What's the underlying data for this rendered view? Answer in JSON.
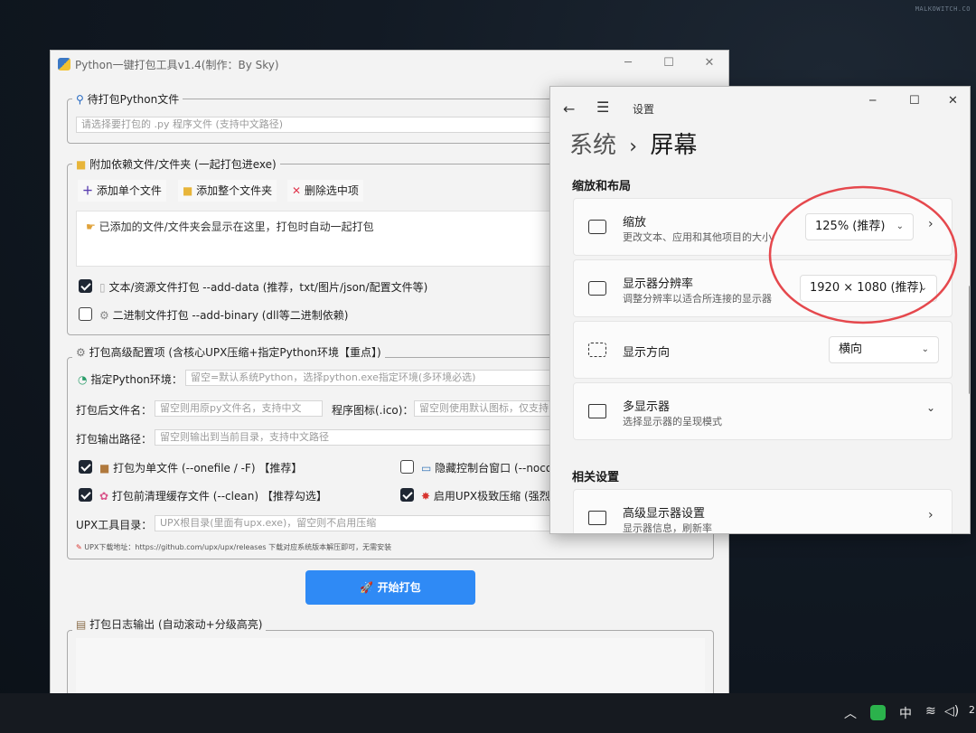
{
  "watermark": "MALKOWITCH.CO",
  "packer": {
    "title": "Python一键打包工具v1.4(制作：By Sky)",
    "file_group": {
      "title": "待打包Python文件",
      "placeholder": "请选择要打包的 .py 程序文件 (支持中文路径)"
    },
    "deps_group": {
      "title": "附加依赖文件/文件夹 (一起打包进exe)",
      "add_file": "添加单个文件",
      "add_folder": "添加整个文件夹",
      "delete": "删除选中项",
      "list_hint": "已添加的文件/文件夹会显示在这里，打包时自动一起打包",
      "opt_data": "文本/资源文件打包 --add-data (推荐，txt/图片/json/配置文件等)",
      "opt_binary": "二进制文件打包 --add-binary (dll等二进制依赖)",
      "opt_data_checked": true,
      "opt_binary_checked": false
    },
    "adv_group": {
      "title": "打包高级配置项 (含核心UPX压缩+指定Python环境【重点】)",
      "env_label": "指定Python环境：",
      "env_placeholder": "留空=默认系统Python，选择python.exe指定环境(多环境必选)",
      "name_label": "打包后文件名：",
      "name_placeholder": "留空则用原py文件名，支持中文",
      "icon_label": "程序图标(.ico)：",
      "icon_placeholder": "留空则使用默认图标，仅支持",
      "out_label": "打包输出路径：",
      "out_placeholder": "留空则输出到当前目录，支持中文路径",
      "onefile": "打包为单文件 (--onefile / -F) 【推荐】",
      "noconsole": "隐藏控制台窗口 (--nocou",
      "clean": "打包前清理缓存文件 (--clean) 【推荐勾选】",
      "upx": "启用UPX极致压缩 (强烈",
      "onefile_checked": true,
      "noconsole_checked": false,
      "clean_checked": true,
      "upx_checked": true,
      "upx_label": "UPX工具目录：",
      "upx_placeholder": "UPX根目录(里面有upx.exe)，留空则不启用压缩",
      "upx_note": "UPX下载地址：https://github.com/upx/upx/releases  下载对应系统版本解压即可，无需安装"
    },
    "start_button": "开始打包",
    "log_group": {
      "title": "打包日志输出 (自动滚动+分级高亮)"
    }
  },
  "settings": {
    "title": "设置",
    "breadcrumb_parent": "系统",
    "breadcrumb_sep": "›",
    "breadcrumb_current": "屏幕",
    "section_layout": "缩放和布局",
    "scale": {
      "title": "缩放",
      "subtitle": "更改文本、应用和其他项目的大小",
      "value": "125% (推荐)"
    },
    "resolution": {
      "title": "显示器分辨率",
      "subtitle": "调整分辨率以适合所连接的显示器",
      "value": "1920 × 1080 (推荐)"
    },
    "orientation": {
      "title": "显示方向",
      "value": "横向"
    },
    "multi": {
      "title": "多显示器",
      "subtitle": "选择显示器的呈现模式"
    },
    "section_related": "相关设置",
    "advanced": {
      "title": "高级显示器设置",
      "subtitle": "显示器信息，刷新率"
    }
  },
  "taskbar": {
    "ime": "中",
    "clock": "2"
  }
}
